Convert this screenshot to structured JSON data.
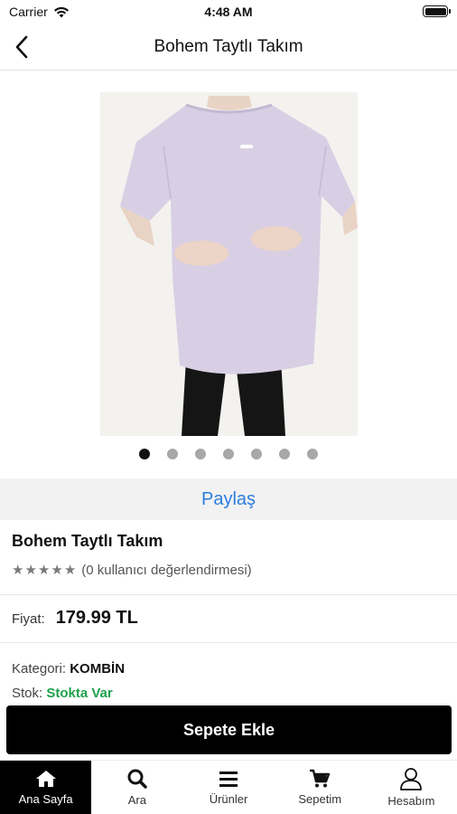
{
  "status": {
    "carrier": "Carrier",
    "time": "4:48 AM"
  },
  "nav": {
    "title": "Bohem Taytlı Takım",
    "back_icon": "chevron-left-icon"
  },
  "gallery": {
    "image_count": 7,
    "active_index": 0
  },
  "share": {
    "label": "Paylaş"
  },
  "product": {
    "name": "Bohem Taytlı Takım",
    "rating_stars": 5,
    "rating_text": "(0 kullanıcı değerlendirmesi)",
    "price_label": "Fiyat:",
    "price": "179.99 TL",
    "category_label": "Kategori:",
    "category": "KOMBİN",
    "stock_label": "Stok:",
    "stock": "Stokta Var"
  },
  "colors": {
    "stock_green": "#1fa14b",
    "share_blue": "#2b7de0",
    "primary": "#000000"
  },
  "actions": {
    "add_to_cart": "Sepete Ekle"
  },
  "tabs": [
    {
      "label": "Ana Sayfa",
      "icon": "home-icon",
      "active": true
    },
    {
      "label": "Ara",
      "icon": "search-icon",
      "active": false
    },
    {
      "label": "Ürünler",
      "icon": "menu-icon",
      "active": false
    },
    {
      "label": "Sepetim",
      "icon": "cart-icon",
      "active": false
    },
    {
      "label": "Hesabım",
      "icon": "user-icon",
      "active": false
    }
  ]
}
